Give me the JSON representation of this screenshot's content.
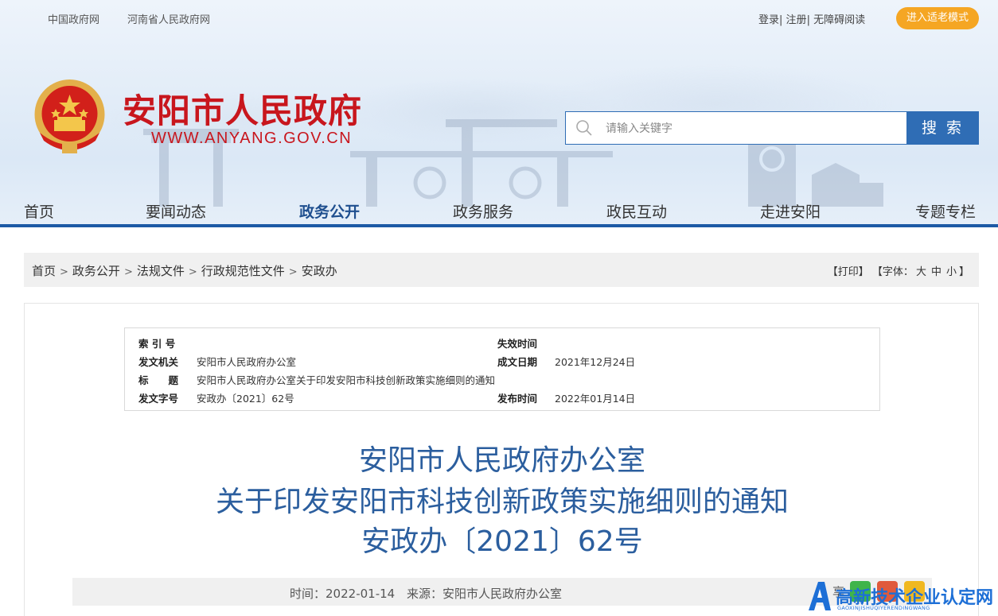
{
  "top_links": [
    "中国政府网",
    "河南省人民政府网"
  ],
  "auth": {
    "login": "登录",
    "register": "注册",
    "accessible": "无障碍阅读",
    "sep": "|"
  },
  "elder_mode": "进入适老模式",
  "site": {
    "name": "安阳市人民政府",
    "url": "WWW.ANYANG.GOV.CN"
  },
  "search": {
    "placeholder": "请输入关键字",
    "button": "搜 索"
  },
  "nav": [
    {
      "label": "首页"
    },
    {
      "label": "要闻动态"
    },
    {
      "label": "政务公开"
    },
    {
      "label": "政务服务"
    },
    {
      "label": "政民互动"
    },
    {
      "label": "走进安阳"
    },
    {
      "label": "专题专栏"
    }
  ],
  "nav_active": "政务公开",
  "breadcrumb": [
    "首页",
    "政务公开",
    "法规文件",
    "行政规范性文件",
    "安政办"
  ],
  "breadcrumb_sep": ">",
  "tools": {
    "print": "【打印】",
    "font_prefix": "【字体：",
    "font_large": "大",
    "font_medium": "中",
    "font_small": "小",
    "font_suffix": "】"
  },
  "meta": {
    "index_label": "索 引 号",
    "index_value": "",
    "expire_label": "失效时间",
    "expire_value": "",
    "issuer_label": "发文机关",
    "issuer_value": "安阳市人民政府办公室",
    "date_label": "成文日期",
    "date_value": "2021年12月24日",
    "title_label": "标　　题",
    "title_value": "安阳市人民政府办公室关于印发安阳市科技创新政策实施细则的通知",
    "doc_no_label": "发文字号",
    "doc_no_value": "安政办〔2021〕62号",
    "publish_label": "发布时间",
    "publish_value": "2022年01月14日"
  },
  "article": {
    "title_line1": "安阳市人民政府办公室",
    "title_line2": "关于印发安阳市科技创新政策实施细则的通知",
    "title_line3": "安政办〔2021〕62号"
  },
  "info": {
    "time_label": "时间：",
    "time": "2022-01-14",
    "source_label": "来源：",
    "source": "安阳市人民政府办公室"
  },
  "share_label": "享",
  "watermark": {
    "text": "高新技术企业认定网",
    "sub": "GAOXINJISHUQIYERENDINGWANG"
  },
  "colors": {
    "brand_red": "#c8161d",
    "brand_blue": "#1d5aa6",
    "title_blue": "#2b5e9e",
    "elder_orange": "#f5a623"
  }
}
